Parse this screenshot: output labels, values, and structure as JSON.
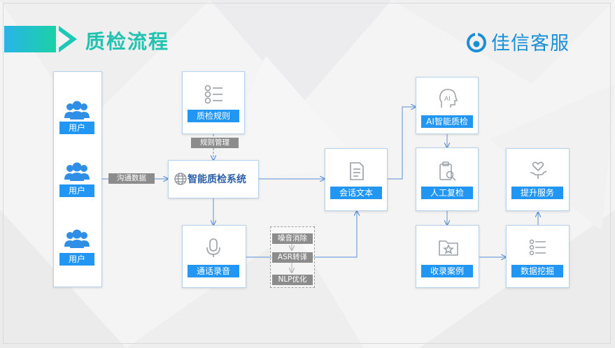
{
  "header": {
    "title": "质检流程",
    "brand": "佳信客服"
  },
  "users": [
    {
      "label": "用户",
      "icon": "users-icon"
    },
    {
      "label": "用户",
      "icon": "users-icon"
    },
    {
      "label": "用户",
      "icon": "users-icon"
    }
  ],
  "nodes": {
    "rules": {
      "label": "质检规则",
      "icon": "list-icon"
    },
    "core": {
      "label": "智能质检系统",
      "icon": "globe-icon"
    },
    "recording": {
      "label": "通话录音",
      "icon": "microphone-icon"
    },
    "session": {
      "label": "会话文本",
      "icon": "document-icon"
    },
    "ai_qc": {
      "label": "AI智能质检",
      "icon": "ai-head-icon"
    },
    "manual_review": {
      "label": "人工复检",
      "icon": "search-document-icon"
    },
    "cases": {
      "label": "收录案例",
      "icon": "folder-star-icon"
    },
    "mining": {
      "label": "数据挖掘",
      "icon": "list-icon"
    },
    "service": {
      "label": "提升服务",
      "icon": "heart-hand-icon"
    }
  },
  "edges": {
    "rule_mgmt": "规则管理",
    "comm_data": "沟通数据"
  },
  "processing": [
    "噪音消除",
    "ASR转译",
    "NLP优化"
  ],
  "colors": {
    "accent": "#2196f3",
    "title": "#20c2b0",
    "brand": "#1b8fd6",
    "tag": "#8c8c8c",
    "line": "#5b8fd4"
  }
}
